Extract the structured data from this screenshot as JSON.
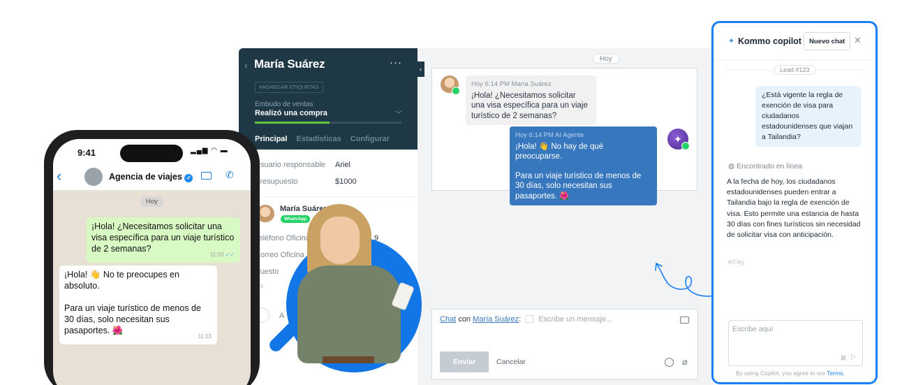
{
  "chat": {
    "day": "Hoy",
    "inbound": {
      "meta": "Hoy 6:14 PM María Suárez",
      "text": "¡Hola! ¿Necesitamos solicitar una visa específica para un viaje turístico de 2 semanas?"
    },
    "outbound": {
      "meta": "Hoy 6:14 PM AI Agente",
      "line1": "¡Hola! 👋 No hay de qué preocuparse.",
      "line2": "Para un viaje turístico de menos de 30 días, solo necesitan sus pasaportes. 🌺"
    },
    "composer": {
      "chat_link": "Chat",
      "con": "con",
      "contact_link": "María Suárez",
      "colon": ":",
      "placeholder": "Escribe un mensaje...",
      "send_label": "Enviar",
      "cancel_label": "Cancelar"
    }
  },
  "lead": {
    "name": "María Suárez",
    "menu": "···",
    "tag_button": "#AGREGAR ETIQUETAS",
    "funnel_label": "Embudo de ventas",
    "funnel_value": "Realizó una compra",
    "funnel_progress": 0.51,
    "tabs": [
      "Principal",
      "Estadísticas",
      "Configurar"
    ],
    "fields": [
      {
        "label": "Usuario responsable",
        "value": "Ariel"
      },
      {
        "label": "Presupuesto",
        "value": "$1000"
      }
    ],
    "contact": {
      "name": "María Suárez",
      "channel": "WhatsApp",
      "fields": [
        "Teléfono Oficina",
        "Correo Oficina",
        "Puesto",
        "...s"
      ],
      "partial_value": "9",
      "add_label": "A"
    }
  },
  "phone": {
    "time": "9:41",
    "status_icons": "▂▄▆ ◠ ▬",
    "chat_title": "Agencia de viajes",
    "day": "Hoy",
    "outgoing": {
      "text": "¡Hola! ¿Necesitamos solicitar una visa específica para un viaje turístico de 2 semanas?",
      "time": "11:03"
    },
    "incoming": {
      "line1": "¡Hola! 👋 No te preocupes en absoluto.",
      "line2": "Para un viaje turístico de menos de 30 días, solo necesitan sus pasaportes. 🌺",
      "time": "11:03"
    }
  },
  "copilot": {
    "title": "Kommo copilot",
    "new_chat": "Nuevo chat",
    "lead_tag": "Lead #123",
    "user_question": "¿Está vigente la regla de exención de visa para ciudadanos estadounidenses que viajan a Tailandia?",
    "found_label": "Encontrado en línea",
    "answer": "A la fecha de hoy, los ciudadanos estadounidenses pueden entrar a Tailandia bajo la regla de exención de visa. Esto permite una estancia de hasta 30 días con fines turísticos sin necesidad de solicitar visa con anticipación.",
    "input_placeholder": "Escribe aquí",
    "footer_text": "By using Copilot, you agree to our",
    "footer_link": "Terms."
  }
}
